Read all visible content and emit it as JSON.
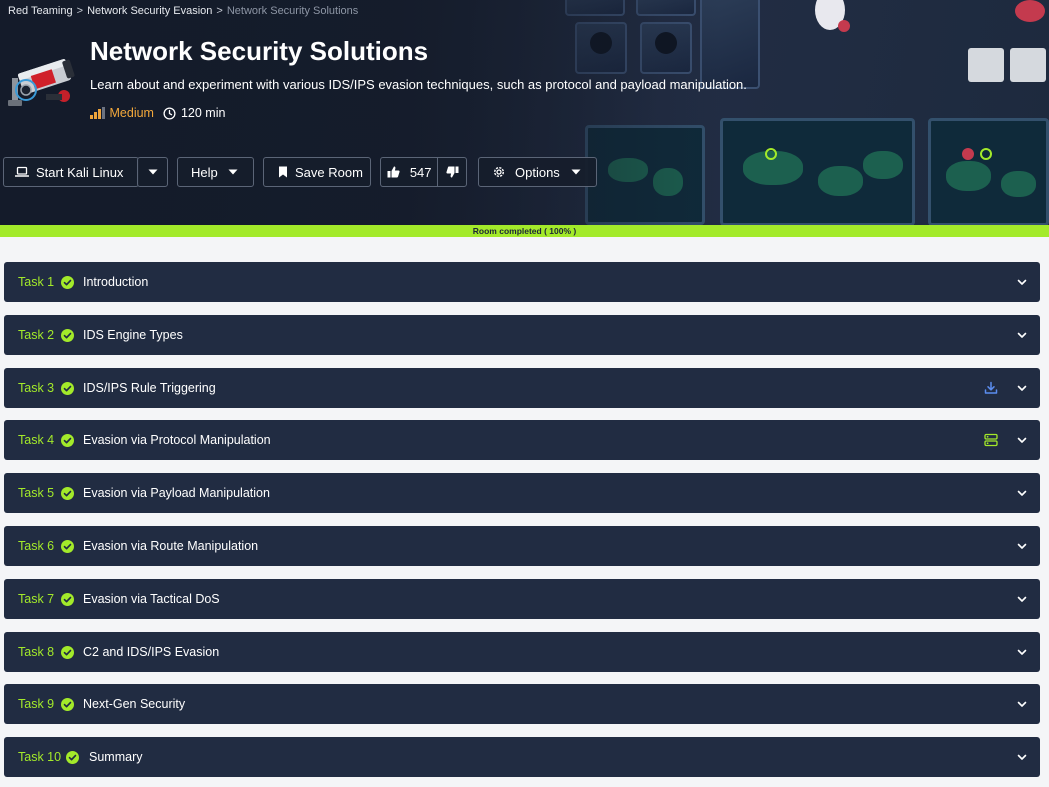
{
  "breadcrumb": {
    "items": [
      "Red Teaming",
      "Network Security Evasion"
    ],
    "separator": ">",
    "current": "Network Security Solutions"
  },
  "room": {
    "title": "Network Security Solutions",
    "description": "Learn about and experiment with various IDS/IPS evasion techniques, such as protocol and payload manipulation.",
    "difficulty": "Medium",
    "duration": "120 min"
  },
  "toolbar": {
    "start_label": "Start Kali Linux",
    "help_label": "Help",
    "save_label": "Save Room",
    "upvotes": "547",
    "options_label": "Options"
  },
  "progress": {
    "label": "Room completed ( 100% )",
    "percent": 100
  },
  "colors": {
    "accent_green": "#a3ea2a",
    "difficulty_orange": "#f3a83b",
    "task_bg": "#212c42",
    "download_blue": "#5b8def"
  },
  "tasks": [
    {
      "num": "Task 1",
      "title": "Introduction",
      "extra_icon": ""
    },
    {
      "num": "Task 2",
      "title": "IDS Engine Types",
      "extra_icon": ""
    },
    {
      "num": "Task 3",
      "title": "IDS/IPS Rule Triggering",
      "extra_icon": "download-icon"
    },
    {
      "num": "Task 4",
      "title": "Evasion via Protocol Manipulation",
      "extra_icon": "server-icon"
    },
    {
      "num": "Task 5",
      "title": "Evasion via Payload Manipulation",
      "extra_icon": ""
    },
    {
      "num": "Task 6",
      "title": "Evasion via Route Manipulation",
      "extra_icon": ""
    },
    {
      "num": "Task 7",
      "title": "Evasion via Tactical DoS",
      "extra_icon": ""
    },
    {
      "num": "Task 8",
      "title": "C2 and IDS/IPS Evasion",
      "extra_icon": ""
    },
    {
      "num": "Task 9",
      "title": "Next-Gen Security",
      "extra_icon": ""
    },
    {
      "num": "Task 10",
      "title": "Summary",
      "extra_icon": ""
    }
  ]
}
